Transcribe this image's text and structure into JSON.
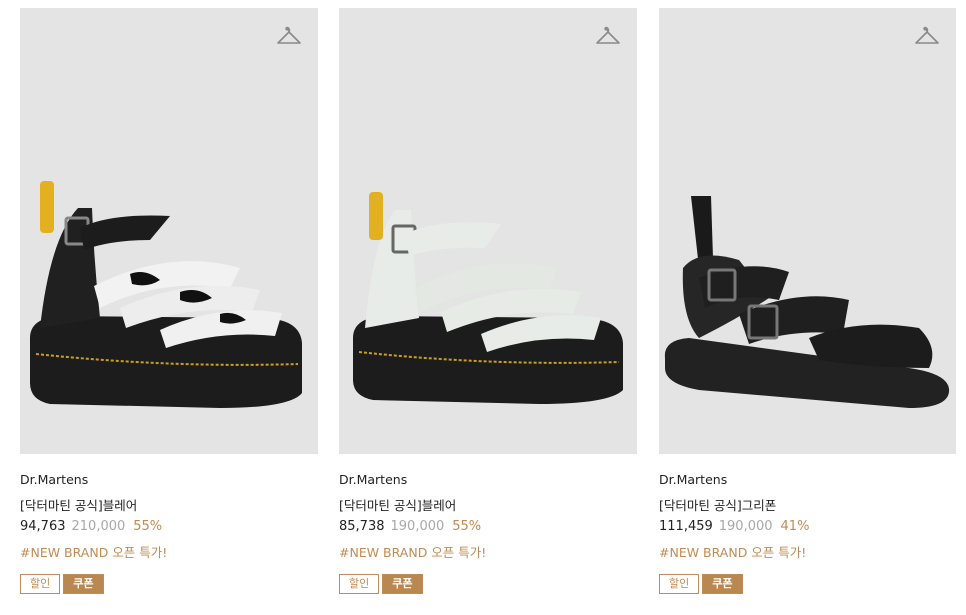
{
  "products": [
    {
      "brand": "Dr.Martens",
      "name": "[닥터마틴 공식]블레어",
      "price": "94,763",
      "original_price": "210,000",
      "discount": "55%",
      "tag": "#NEW BRAND 오픈 특가!",
      "badges": {
        "sale": "할인",
        "coupon": "쿠폰"
      }
    },
    {
      "brand": "Dr.Martens",
      "name": "[닥터마틴 공식]블레어",
      "price": "85,738",
      "original_price": "190,000",
      "discount": "55%",
      "tag": "#NEW BRAND 오픈 특가!",
      "badges": {
        "sale": "할인",
        "coupon": "쿠폰"
      }
    },
    {
      "brand": "Dr.Martens",
      "name": "[닥터마틴 공식]그리폰",
      "price": "111,459",
      "original_price": "190,000",
      "discount": "41%",
      "tag": "#NEW BRAND 오픈 특가!",
      "badges": {
        "sale": "할인",
        "coupon": "쿠폰"
      }
    }
  ],
  "colors": {
    "accent": "#c08b55",
    "coupon_bg": "#b98750",
    "image_bg": "#e4e4e4",
    "text": "#222222",
    "muted": "#a8a8a8"
  },
  "icons": {
    "wishlist": "hanger-icon"
  }
}
